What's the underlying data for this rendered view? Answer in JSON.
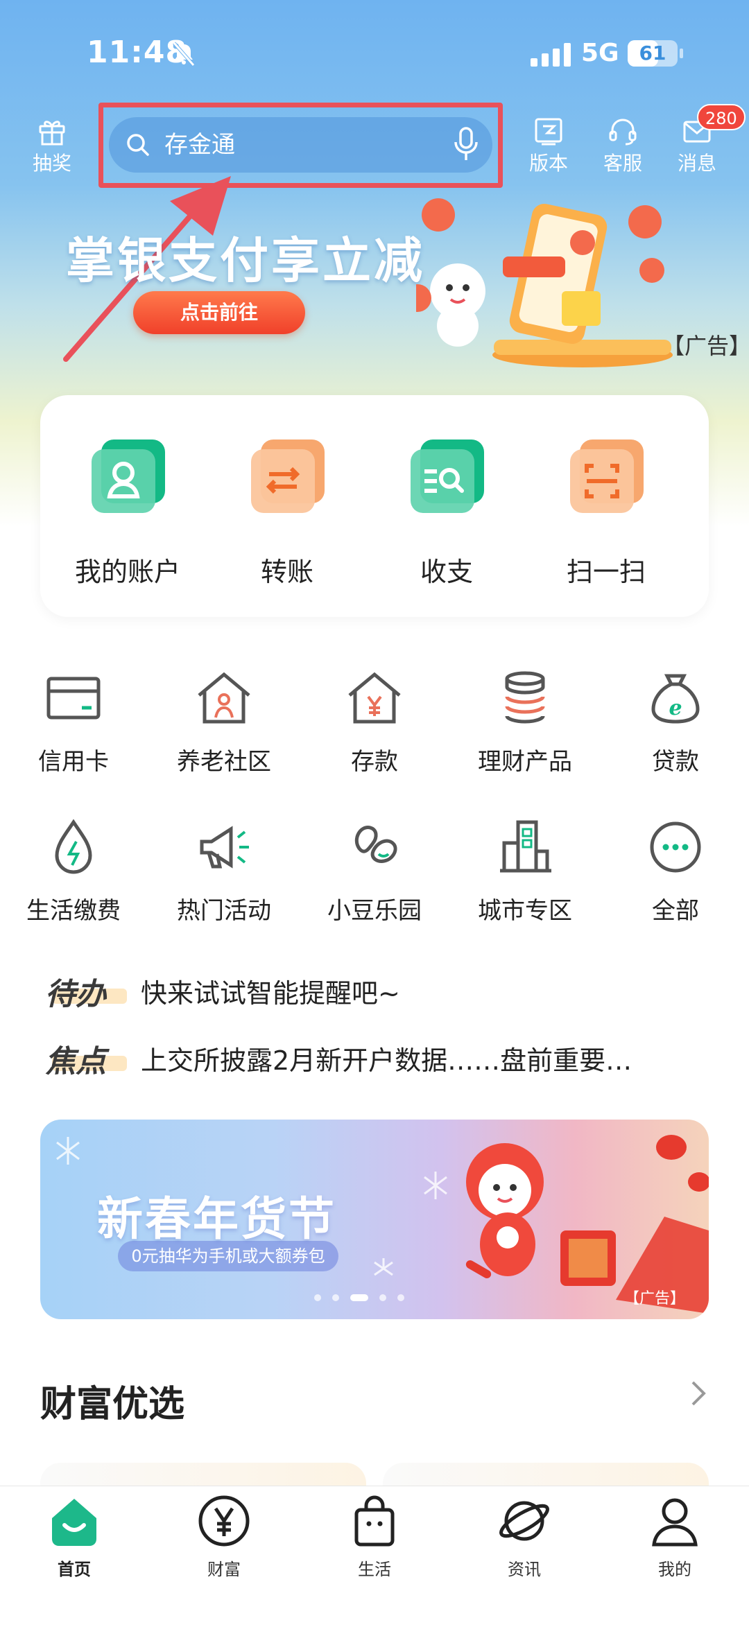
{
  "status_bar": {
    "time": "11:48",
    "network": "5G",
    "battery": "61",
    "battery_level": 0.61
  },
  "header": {
    "lottery_label": "抽奖",
    "search_placeholder": "存金通",
    "version_label": "版本",
    "service_label": "客服",
    "message_label": "消息",
    "message_badge": "280"
  },
  "top_banner": {
    "title": "掌银支付享立减",
    "cta": "点击前往",
    "ad_tag": "【广告】"
  },
  "quick_actions": [
    {
      "label": "我的账户",
      "icon": "account-icon"
    },
    {
      "label": "转账",
      "icon": "transfer-icon"
    },
    {
      "label": "收支",
      "icon": "income-expense-icon"
    },
    {
      "label": "扫一扫",
      "icon": "scan-icon"
    }
  ],
  "service_grid": [
    {
      "label": "信用卡",
      "icon": "credit-card-icon"
    },
    {
      "label": "养老社区",
      "icon": "elderly-community-icon"
    },
    {
      "label": "存款",
      "icon": "deposit-icon"
    },
    {
      "label": "理财产品",
      "icon": "wealth-products-icon"
    },
    {
      "label": "贷款",
      "icon": "loan-icon"
    },
    {
      "label": "生活缴费",
      "icon": "utility-payment-icon"
    },
    {
      "label": "热门活动",
      "icon": "megaphone-icon"
    },
    {
      "label": "小豆乐园",
      "icon": "bean-park-icon"
    },
    {
      "label": "城市专区",
      "icon": "city-zone-icon"
    },
    {
      "label": "全部",
      "icon": "more-icon"
    }
  ],
  "notices": [
    {
      "tag": "待办",
      "text": "快来试试智能提醒吧~"
    },
    {
      "tag": "焦点",
      "text": "上交所披露2月新开户数据……盘前重要…"
    }
  ],
  "promo_banner": {
    "title": "新春年货节",
    "subtitle": "0元抽华为手机或大额券包",
    "ad_tag": "【广告】",
    "pages": 5,
    "active_page": 3
  },
  "section": {
    "title": "财富优选"
  },
  "tabbar": [
    {
      "label": "首页",
      "icon": "home-icon",
      "active": true
    },
    {
      "label": "财富",
      "icon": "yen-icon",
      "active": false
    },
    {
      "label": "生活",
      "icon": "shopping-bag-icon",
      "active": false
    },
    {
      "label": "资讯",
      "icon": "planet-icon",
      "active": false
    },
    {
      "label": "我的",
      "icon": "user-icon",
      "active": false
    }
  ],
  "colors": {
    "accent": "#1db88a",
    "highlight_border": "#e9515a",
    "badge": "#f0463c"
  }
}
